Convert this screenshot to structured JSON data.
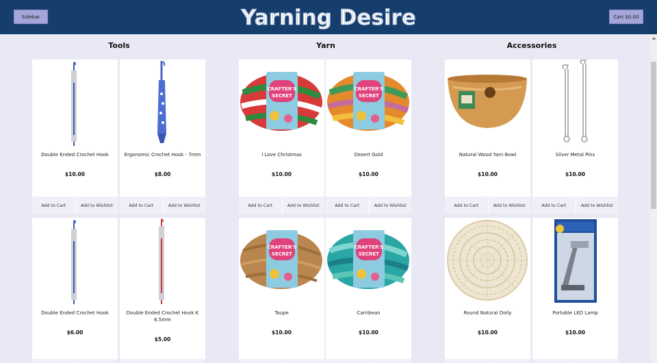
{
  "header": {
    "sidebar_label": "Sidebar",
    "logo_text": "Yarning Desire",
    "cart_label": "Cart $0.00"
  },
  "columns": [
    {
      "title": "Tools"
    },
    {
      "title": "Yarn"
    },
    {
      "title": "Accessories"
    }
  ],
  "products": [
    {
      "name": "Double Ended Crochet Hook",
      "price": "$10.00",
      "image_icon": "crochet-hook-blue-icon"
    },
    {
      "name": "Ergonomic Crochet Hook - 7mm",
      "price": "$8.00",
      "image_icon": "ergonomic-hook-icon"
    },
    {
      "name": "I Love Christmas",
      "price": "$10.00",
      "image_icon": "yarn-christmas-icon"
    },
    {
      "name": "Desert Gold",
      "price": "$10.00",
      "image_icon": "yarn-desert-gold-icon"
    },
    {
      "name": "Natural Wood Yarn Bowl",
      "price": "$10.00",
      "image_icon": "yarn-bowl-icon"
    },
    {
      "name": "Silver Metal Pins",
      "price": "$10.00",
      "image_icon": "safety-pins-icon"
    },
    {
      "name": "Double Ended Crochet Hook",
      "price": "$6.00",
      "image_icon": "crochet-hook-blue-icon"
    },
    {
      "name": "Double Ended Crochet Hook K 6.5mm",
      "price": "$5.00",
      "image_icon": "crochet-hook-red-icon"
    },
    {
      "name": "Taupe",
      "price": "$10.00",
      "image_icon": "yarn-taupe-icon"
    },
    {
      "name": "Carribean",
      "price": "$10.00",
      "image_icon": "yarn-carribean-icon"
    },
    {
      "name": "Round Natural Doily",
      "price": "$10.00",
      "image_icon": "doily-icon"
    },
    {
      "name": "Portable LED Lamp",
      "price": "$10.00",
      "image_icon": "led-lamp-icon"
    }
  ],
  "buttons": {
    "add_to_cart": "Add to Cart",
    "add_to_wishlist": "Add to Wishlist"
  },
  "colors": {
    "header_bg": "#163e6c",
    "page_bg": "#e9e9f5",
    "header_button_bg": "#a5a5da",
    "card_button_bg": "#efeff8"
  }
}
